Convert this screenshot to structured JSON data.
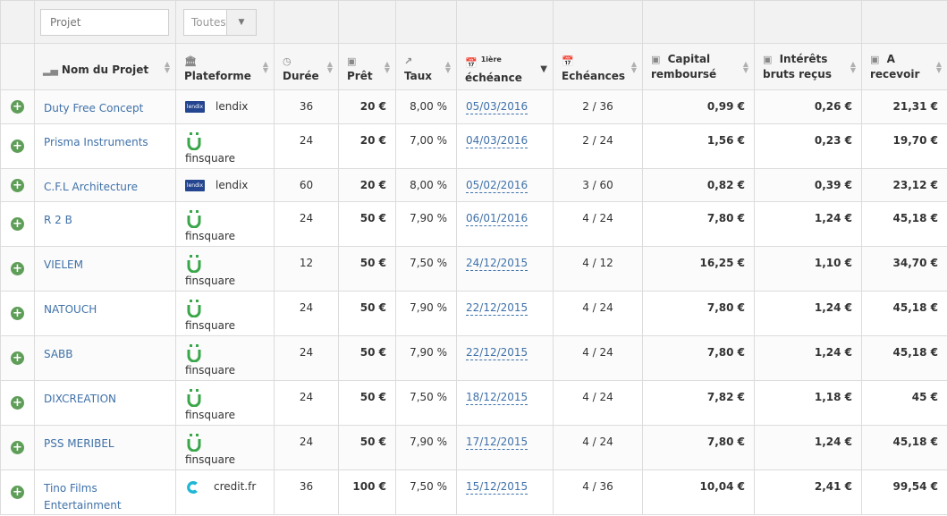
{
  "filters": {
    "project_placeholder": "Projet",
    "platform_value": "Toutes"
  },
  "columns": {
    "name": "Nom du Projet",
    "platform": "Plateforme",
    "duration": "Durée",
    "loan": "Prêt",
    "rate": "Taux",
    "first_due_sup": "1ière",
    "first_due": "échéance",
    "due_count": "Echéances",
    "capital_l1": "Capital",
    "capital_l2": "remboursé",
    "interest_l1": "Intérêts",
    "interest_l2": "bruts reçus",
    "receivable_l1": "A",
    "receivable_l2": "recevoir"
  },
  "icons": {
    "name": "bar-chart-icon",
    "platform": "bank-icon",
    "duration": "clock-icon",
    "loan": "money-icon",
    "rate": "line-chart-icon",
    "date": "calendar-icon",
    "row_add": "plus-circle-icon"
  },
  "colors": {
    "link": "#3f71a8",
    "add": "#5f9e58",
    "lendix": "#24458f",
    "finsquare": "#3aa64a",
    "credit": "#1fb7d4"
  },
  "rows": [
    {
      "name": "Duty Free Concept",
      "platform": "lendix",
      "logo": "lendix",
      "duration": "36",
      "loan": "20 €",
      "rate": "8,00 %",
      "first_due": "05/03/2016",
      "due_count": "2 / 36",
      "capital": "0,99 €",
      "interest": "0,26 €",
      "receivable": "21,31 €"
    },
    {
      "name": "Prisma Instruments",
      "platform": "finsquare",
      "logo": "finsquare",
      "duration": "24",
      "loan": "20 €",
      "rate": "7,00 %",
      "first_due": "04/03/2016",
      "due_count": "2 / 24",
      "capital": "1,56 €",
      "interest": "0,23 €",
      "receivable": "19,70 €"
    },
    {
      "name": "C.F.L Architecture",
      "platform": "lendix",
      "logo": "lendix",
      "duration": "60",
      "loan": "20 €",
      "rate": "8,00 %",
      "first_due": "05/02/2016",
      "due_count": "3 / 60",
      "capital": "0,82 €",
      "interest": "0,39 €",
      "receivable": "23,12 €"
    },
    {
      "name": "R 2 B",
      "platform": "finsquare",
      "logo": "finsquare",
      "duration": "24",
      "loan": "50 €",
      "rate": "7,90 %",
      "first_due": "06/01/2016",
      "due_count": "4 / 24",
      "capital": "7,80 €",
      "interest": "1,24 €",
      "receivable": "45,18 €"
    },
    {
      "name": "VIELEM",
      "platform": "finsquare",
      "logo": "finsquare",
      "duration": "12",
      "loan": "50 €",
      "rate": "7,50 %",
      "first_due": "24/12/2015",
      "due_count": "4 / 12",
      "capital": "16,25 €",
      "interest": "1,10 €",
      "receivable": "34,70 €"
    },
    {
      "name": "NATOUCH",
      "platform": "finsquare",
      "logo": "finsquare",
      "duration": "24",
      "loan": "50 €",
      "rate": "7,90 %",
      "first_due": "22/12/2015",
      "due_count": "4 / 24",
      "capital": "7,80 €",
      "interest": "1,24 €",
      "receivable": "45,18 €"
    },
    {
      "name": "SABB",
      "platform": "finsquare",
      "logo": "finsquare",
      "duration": "24",
      "loan": "50 €",
      "rate": "7,90 %",
      "first_due": "22/12/2015",
      "due_count": "4 / 24",
      "capital": "7,80 €",
      "interest": "1,24 €",
      "receivable": "45,18 €"
    },
    {
      "name": "DIXCREATION",
      "platform": "finsquare",
      "logo": "finsquare",
      "duration": "24",
      "loan": "50 €",
      "rate": "7,50 %",
      "first_due": "18/12/2015",
      "due_count": "4 / 24",
      "capital": "7,82 €",
      "interest": "1,18 €",
      "receivable": "45 €"
    },
    {
      "name": "PSS MERIBEL",
      "platform": "finsquare",
      "logo": "finsquare",
      "duration": "24",
      "loan": "50 €",
      "rate": "7,90 %",
      "first_due": "17/12/2015",
      "due_count": "4 / 24",
      "capital": "7,80 €",
      "interest": "1,24 €",
      "receivable": "45,18 €"
    },
    {
      "name": "Tino Films Entertainment",
      "platform": "credit.fr",
      "logo": "credit",
      "duration": "36",
      "loan": "100 €",
      "rate": "7,50 %",
      "first_due": "15/12/2015",
      "due_count": "4 / 36",
      "capital": "10,04 €",
      "interest": "2,41 €",
      "receivable": "99,54 €"
    }
  ]
}
